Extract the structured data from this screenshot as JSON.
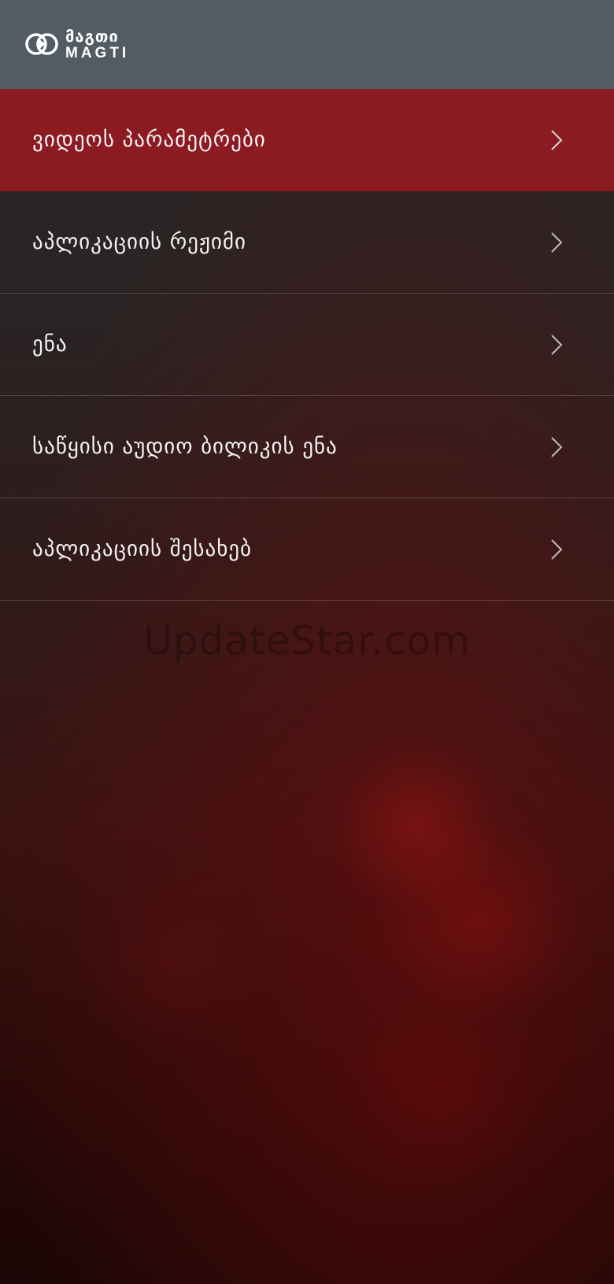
{
  "header": {
    "logo_georgian": "მაგთი",
    "logo_latin": "MAGTI",
    "background_color": "#535c63"
  },
  "menu": {
    "active_color": "#8b1a21",
    "items": [
      {
        "label": "ვიდეოს პარამეტრები",
        "active": true,
        "icon": "chevron-right-icon"
      },
      {
        "label": "აპლიკაციის რეჟიმი",
        "active": false,
        "icon": "chevron-right-icon"
      },
      {
        "label": "ენა",
        "active": false,
        "icon": "chevron-right-icon"
      },
      {
        "label": "საწყისი აუდიო ბილიკის ენა",
        "active": false,
        "icon": "chevron-right-icon"
      },
      {
        "label": "აპლიკაციის შესახებ",
        "active": false,
        "icon": "chevron-right-icon"
      }
    ]
  },
  "watermark": {
    "text": "UpdateStar.com"
  }
}
